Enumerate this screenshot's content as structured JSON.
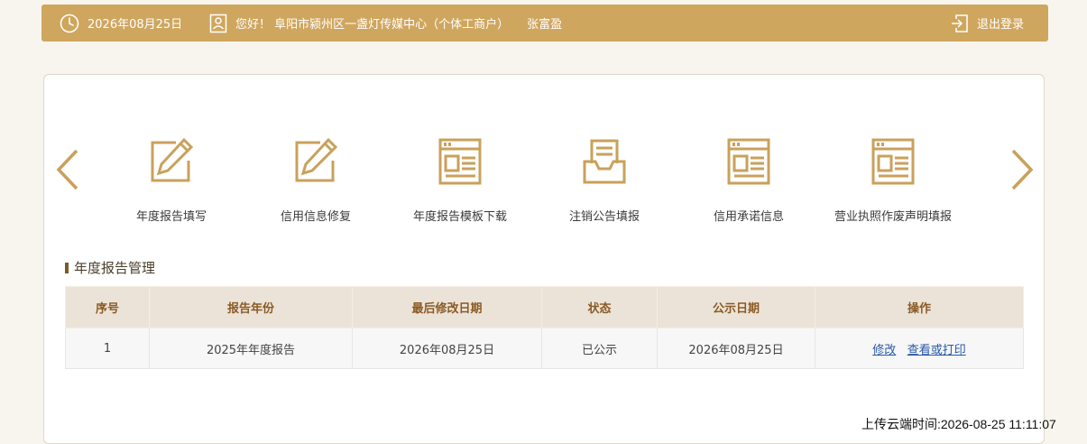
{
  "header": {
    "date": "2026年08月25日",
    "greeting": "您好！ 阜阳市颍州区一盏灯传媒中心（个体工商户）",
    "user_name": "张富盈",
    "logout_label": "退出登录"
  },
  "menu": {
    "items": [
      {
        "label": "年度报告填写",
        "icon": "edit-icon"
      },
      {
        "label": "信用信息修复",
        "icon": "edit-icon"
      },
      {
        "label": "年度报告模板下载",
        "icon": "template-icon"
      },
      {
        "label": "注销公告填报",
        "icon": "inbox-tray-icon"
      },
      {
        "label": "信用承诺信息",
        "icon": "template-icon"
      },
      {
        "label": "营业执照作废声明填报",
        "icon": "template-icon"
      }
    ]
  },
  "section": {
    "title": "年度报告管理"
  },
  "table": {
    "headers": [
      "序号",
      "报告年份",
      "最后修改日期",
      "状态",
      "公示日期",
      "操作"
    ],
    "rows": [
      {
        "index": "1",
        "year": "2025年年度报告",
        "modified": "2026年08月25日",
        "status": "已公示",
        "publish_date": "2026年08月25日",
        "action_edit": "修改",
        "action_view": "查看或打印"
      }
    ]
  },
  "footer": {
    "upload_time": "上传云端时间:2026-08-25 11:11:07"
  },
  "colors": {
    "accent": "#cfa65e",
    "icon": "#c9a15b",
    "header_text": "#8a5a24",
    "link": "#2a58a8"
  }
}
